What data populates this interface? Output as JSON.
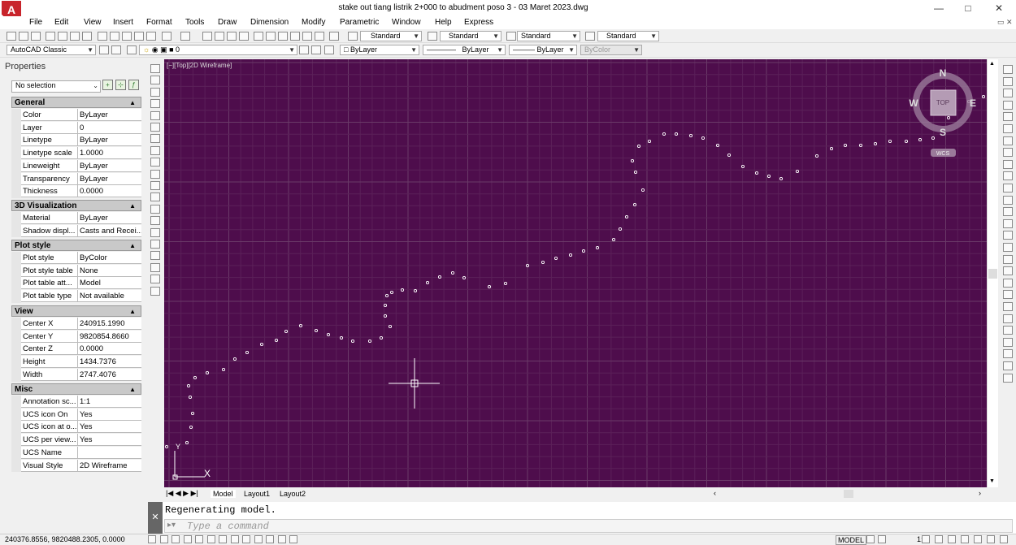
{
  "window": {
    "title": "stake out tiang listrik 2+000  to abudment poso 3  - 03 Maret 2023.dwg",
    "logo": "A",
    "min": "—",
    "max": "□",
    "close": "✕"
  },
  "menu": [
    "File",
    "Edit",
    "View",
    "Insert",
    "Format",
    "Tools",
    "Draw",
    "Dimension",
    "Modify",
    "Parametric",
    "Window",
    "Help",
    "Express"
  ],
  "toolbar": {
    "text_style": "Standard",
    "dim_style": "Standard",
    "table_style": "Standard",
    "mleader_style": "Standard",
    "workspace": "AutoCAD Classic",
    "layer": "0",
    "color": "ByLayer",
    "linetype": "ByLayer",
    "lineweight": "ByLayer",
    "plotstyle": "ByColor"
  },
  "properties": {
    "title": "Properties",
    "selection": "No selection",
    "sections": [
      {
        "title": "General",
        "rows": [
          [
            "Color",
            "ByLayer"
          ],
          [
            "Layer",
            "0"
          ],
          [
            "Linetype",
            "ByLayer"
          ],
          [
            "Linetype scale",
            "1.0000"
          ],
          [
            "Lineweight",
            "ByLayer"
          ],
          [
            "Transparency",
            "ByLayer"
          ],
          [
            "Thickness",
            "0.0000"
          ]
        ]
      },
      {
        "title": "3D Visualization",
        "rows": [
          [
            "Material",
            "ByLayer"
          ],
          [
            "Shadow displ...",
            "Casts and Recei..."
          ]
        ]
      },
      {
        "title": "Plot style",
        "rows": [
          [
            "Plot style",
            "ByColor"
          ],
          [
            "Plot style table",
            "None"
          ],
          [
            "Plot table att...",
            "Model"
          ],
          [
            "Plot table type",
            "Not available"
          ]
        ]
      },
      {
        "title": "View",
        "rows": [
          [
            "Center X",
            "240915.1990"
          ],
          [
            "Center Y",
            "9820854.8660"
          ],
          [
            "Center Z",
            "0.0000"
          ],
          [
            "Height",
            "1434.7376"
          ],
          [
            "Width",
            "2747.4076"
          ]
        ]
      },
      {
        "title": "Misc",
        "rows": [
          [
            "Annotation sc...",
            "1:1"
          ],
          [
            "UCS icon On",
            "Yes"
          ],
          [
            "UCS icon at o...",
            "Yes"
          ],
          [
            "UCS per view...",
            "Yes"
          ],
          [
            "UCS Name",
            ""
          ],
          [
            "Visual Style",
            "2D Wireframe"
          ]
        ]
      }
    ]
  },
  "viewport": {
    "label": "[−][Top][2D Wireframe]",
    "bg": "#4e0d4c"
  },
  "viewcube": {
    "n": "N",
    "s": "S",
    "e": "E",
    "w": "W",
    "top": "TOP",
    "wcs": "WCS"
  },
  "ucs": {
    "x": "X",
    "y": "Y"
  },
  "tabs": [
    "Model",
    "Layout1",
    "Layout2"
  ],
  "command": {
    "history": "Regenerating model.",
    "placeholder": "Type a command"
  },
  "status": {
    "coords": "240376.8556, 9820488.2305, 0.0000",
    "model": "MODEL",
    "scale": "1:1"
  }
}
